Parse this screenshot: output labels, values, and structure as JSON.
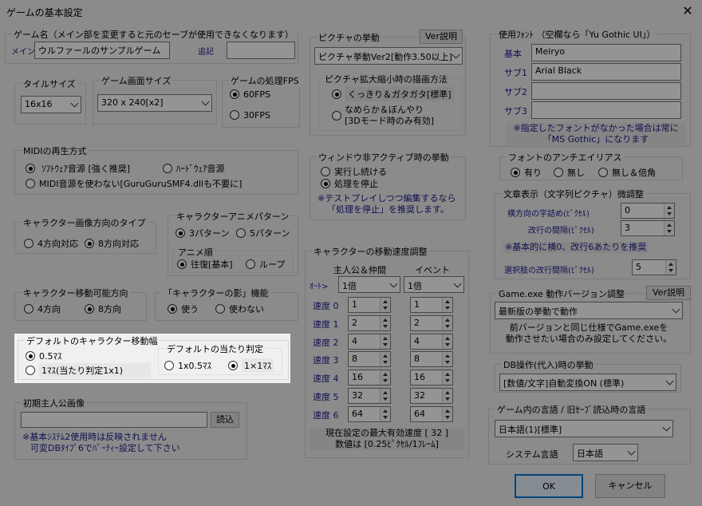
{
  "window": {
    "title": "ゲームの基本設定",
    "close": "✕"
  },
  "game_name": {
    "label": "ゲーム名（メイン部を変更すると元のセーブが使用できなくなります）",
    "main_label": "メイン",
    "main_value": "ウルファールのサンプルゲーム",
    "sub_label": "追記",
    "sub_value": ""
  },
  "tile_size": {
    "label": "タイルサイズ",
    "value": "16x16"
  },
  "screen_size": {
    "label": "ゲーム画面サイズ",
    "value": "320 x 240[x2]"
  },
  "fps": {
    "label": "ゲームの処理FPS",
    "options": [
      "60FPS",
      "30FPS"
    ]
  },
  "picture": {
    "label": "ピクチャの挙動",
    "ver_button": "Ver説明",
    "value": "ピクチャ挙動Ver2[動作3.50以上]",
    "scale_label": "ピクチャ拡大縮小時の描画方法",
    "scale_opt1": "くっきり＆ガタガタ[標準]",
    "scale_opt2_l1": "なめらか＆ぼんやり",
    "scale_opt2_l2": "[3Dモード時のみ有効]"
  },
  "midi": {
    "label": "MIDIの再生方式",
    "opt1": "ｿﾌﾄｳｪｱ音源 [強く推奨]",
    "opt2": "ﾊｰﾄﾞｳｪｱ音源",
    "opt3": "MIDI音源を使わない[GuruGuruSMF4.dllも不要に]"
  },
  "inactive": {
    "label": "ウィンドウ非アクティブ時の挙動",
    "opt1": "実行し続ける",
    "opt2": "処理を停止",
    "note1": "※テストプレイしつつ編集するなら",
    "note2": "「処理を停止」を推奨します。"
  },
  "char_dir": {
    "label": "キャラクター画像方向のタイプ",
    "opt1": "4方向対応",
    "opt2": "8方向対応"
  },
  "char_anim": {
    "label": "キャラクターアニメパターン",
    "opt1": "3パターン",
    "opt2": "5パターン",
    "order_label": "アニメ順",
    "order1": "往復[基本]",
    "order2": "ループ"
  },
  "char_move_dir": {
    "label": "キャラクター移動可能方向",
    "opt1": "4方向",
    "opt2": "8方向"
  },
  "char_shadow": {
    "label": "「キャラクターの影」機能",
    "opt1": "使う",
    "opt2": "使わない"
  },
  "move_width": {
    "label": "デフォルトのキャラクター移動幅",
    "opt1": "0.5ﾏｽ",
    "opt2": "1ﾏｽ(当たり判定1x1)"
  },
  "hit": {
    "label": "デフォルトの当たり判定",
    "opt1": "1x0.5ﾏｽ",
    "opt2": "1×1ﾏｽ"
  },
  "init_hero": {
    "label": "初期主人公画像",
    "button": "読込",
    "note1": "※基本ｼｽﾃﾑ2使用時は反映されません",
    "note2": "可変DBﾀｲﾌﾟ6でﾊﾟｰﾃｨｰ設定して下さい"
  },
  "speed": {
    "label": "キャラクターの移動速度調整",
    "col1": "主人公＆仲間",
    "col2": "イベント",
    "auto_label": "ｵｰﾄ>",
    "auto_hero": "1倍",
    "auto_event": "1倍",
    "rows": [
      {
        "label": "速度 0",
        "hero": "1",
        "event": "1"
      },
      {
        "label": "速度 1",
        "hero": "2",
        "event": "2"
      },
      {
        "label": "速度 2",
        "hero": "4",
        "event": "4"
      },
      {
        "label": "速度 3",
        "hero": "8",
        "event": "8"
      },
      {
        "label": "速度 4",
        "hero": "16",
        "event": "16"
      },
      {
        "label": "速度 5",
        "hero": "32",
        "event": "32"
      },
      {
        "label": "速度 6",
        "hero": "64",
        "event": "64"
      }
    ],
    "note1": "現在設定の最大有効速度 [ 32 ]",
    "note2": "数値は [0.25ﾋﾟｸｾﾙ/1ﾌﾚｰﾑ]"
  },
  "fonts": {
    "label": "使用ﾌｫﾝﾄ （空欄なら「Yu Gothic UI」）",
    "rows": [
      {
        "label": "基本",
        "value": "Meiryo"
      },
      {
        "label": "サブ1",
        "value": "Arial Black"
      },
      {
        "label": "サブ2",
        "value": ""
      },
      {
        "label": "サブ3",
        "value": ""
      }
    ],
    "note1": "※指定したフォントがなかった場合は常に",
    "note2": "「MS Gothic」になります"
  },
  "antialias": {
    "label": "フォントのアンチエイリアス",
    "opt1": "有り",
    "opt2": "無し",
    "opt3": "無し＆倍角"
  },
  "text_display": {
    "label": "文章表示（文字列ピクチャ）微調整",
    "h_label": "横方向の字詰め(ﾋﾟｸｾﾙ)",
    "h_value": "0",
    "lf_label": "改行の間隔(ﾋﾟｸｾﾙ)",
    "lf_value": "3",
    "note": "※基本的に横0、改行6あたりを推奨",
    "choice_label": "選択肢の改行間隔(ﾋﾟｸｾﾙ)",
    "choice_value": "5"
  },
  "exe_version": {
    "label": "Game.exe 動作バージョン調整",
    "ver_button": "Ver説明",
    "value": "最新版の挙動で動作",
    "note1": "前バージョンと同じ仕様でGame.exeを",
    "note2": "動作させたい場合のみ設定してください。"
  },
  "db_op": {
    "label": "DB操作(代入)時の挙動",
    "value": "[数値/文字]自動変換ON (標準)"
  },
  "language": {
    "label": "ゲーム内の言語 / 旧ｾｰﾌﾞ読込時の言語",
    "value": "日本語(1)[標準]",
    "sys_label": "システム言語",
    "sys_value": "日本語"
  },
  "footer": {
    "ok": "OK",
    "cancel": "キャンセル"
  }
}
